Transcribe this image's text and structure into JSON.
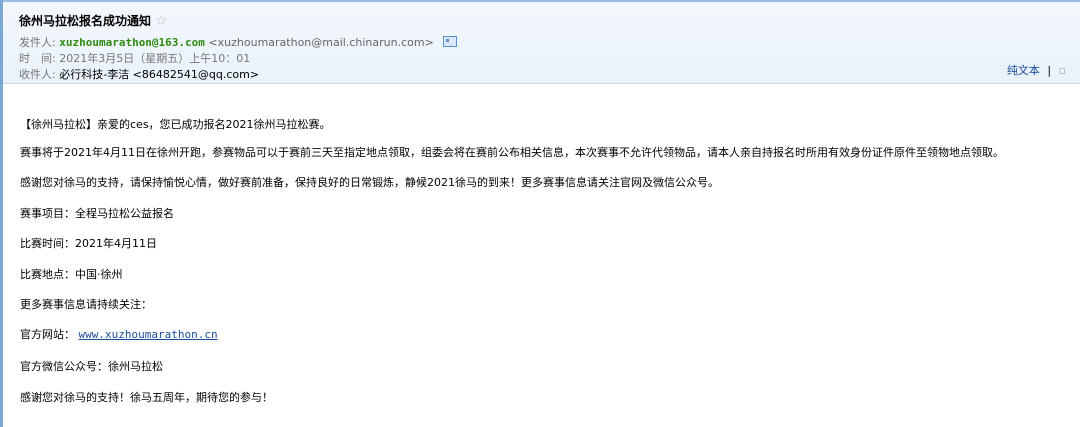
{
  "header": {
    "subject": "徐州马拉松报名成功通知",
    "from_label": "发件人:",
    "from_name": "xuzhoumarathon@163.com",
    "from_address": "<xuzhoumarathon@mail.chinarun.com>",
    "time_label": "时　间:",
    "time_value": "2021年3月5日（星期五）上午10：01",
    "to_label": "收件人:",
    "to_value": "必行科技-李洁 <86482541@qq.com>",
    "plain_text_link": "纯文本",
    "separator": "|"
  },
  "body": {
    "line1": "【徐州马拉松】亲爱的ces，您已成功报名2021徐州马拉松赛。",
    "line2": "赛事将于2021年4月11日在徐州开跑，参赛物品可以于赛前三天至指定地点领取，组委会将在赛前公布相关信息，本次赛事不允许代领物品，请本人亲自持报名时所用有效身份证件原件至领物地点领取。",
    "line3": "感谢您对徐马的支持，请保持愉悦心情，做好赛前准备，保持良好的日常锻炼，静候2021徐马的到来！更多赛事信息请关注官网及微信公众号。",
    "line4": "赛事项目：全程马拉松公益报名",
    "line5": "比赛时间：2021年4月11日",
    "line6": "比赛地点：中国·徐州",
    "line7": "更多赛事信息请持续关注：",
    "website_label": "官方网站：",
    "website_url": "www.xuzhoumarathon.cn",
    "line9": "官方微信公众号：徐州马拉松",
    "line10": "感谢您对徐马的支持！徐马五周年，期待您的参与！"
  },
  "colors": {
    "sender_green": "#2e8b10",
    "link_blue": "#1a4d9c",
    "header_bg": "#eaf1fa"
  }
}
